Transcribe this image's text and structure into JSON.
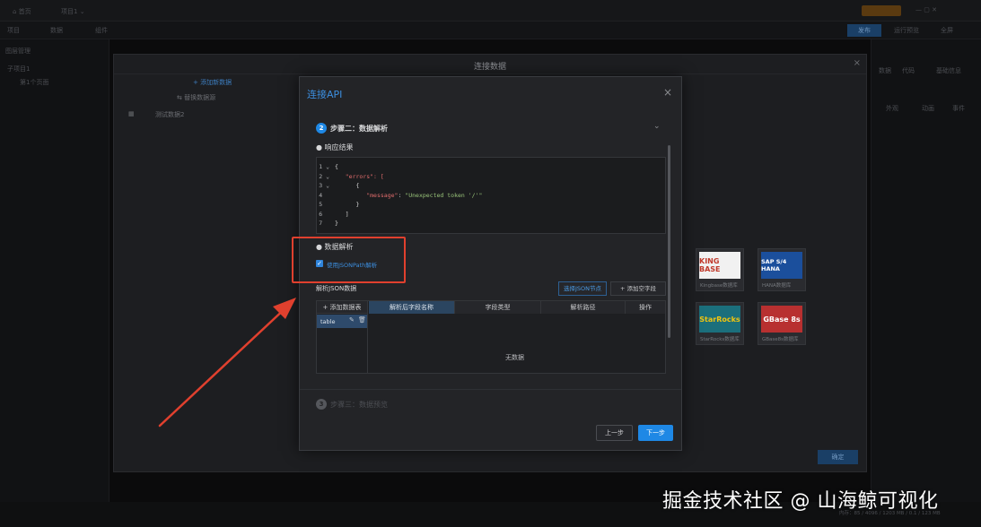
{
  "app": {
    "home_label": "首页",
    "project_label": "项目1",
    "toolbar": [
      "项目",
      "数据",
      "组件"
    ],
    "right_buttons": [
      "发布",
      "运行预览",
      "全屏"
    ],
    "left_panel": {
      "title": "图层管理",
      "group": "子项目1",
      "item": "第1个页面",
      "add_data_label": "+ 添加新数据",
      "replace_source_label": "替换数据源",
      "test_data_label": "测试数据2"
    },
    "right_panel": {
      "tabs": [
        "数据",
        "代码",
        "基础信息"
      ],
      "fields": [
        "外观",
        "动画",
        "事件"
      ]
    },
    "save_label": "确定",
    "bottom_status": "内存：85 / 4096 / 1203 MB / 0.1 / 123 MB"
  },
  "connect_modal": {
    "title": "连接数据",
    "close_icon": "×",
    "cards": [
      {
        "logo": "KING BASE",
        "caption": "Kingbase数据库",
        "logo_color": "#c0392b",
        "logo_bg": "#f1f1f1"
      },
      {
        "logo": "SAP S/4 HANA",
        "caption": "HANA数据库",
        "logo_color": "#ffffff",
        "logo_bg": "#1b4f9c"
      },
      {
        "logo": "StarRocks",
        "caption": "StarRocks数据库",
        "logo_color": "#f1c40f",
        "logo_bg": "#1b6f7c"
      },
      {
        "logo": "GBase 8s",
        "caption": "GBase8s数据库",
        "logo_color": "#ffffff",
        "logo_bg": "#b83030"
      }
    ]
  },
  "dialog": {
    "title": "连接API",
    "close_icon": "×",
    "step2": {
      "num": "2",
      "label": "步骤二：数据解析"
    },
    "step3": {
      "num": "3",
      "label": "步骤三：数据预览"
    },
    "response_label": "● 响应结果",
    "response_lines": [
      {
        "n": "1",
        "text": "{",
        "type": "brace",
        "indent": 0,
        "fold": true
      },
      {
        "n": "2",
        "text": "\"errors\": [",
        "type": "key",
        "indent": 1,
        "fold": true
      },
      {
        "n": "3",
        "text": "{",
        "type": "brace",
        "indent": 2,
        "fold": true
      },
      {
        "n": "4",
        "key": "\"message\"",
        "value": "\"Unexpected token '/'\"",
        "type": "kv",
        "indent": 3,
        "fold": false
      },
      {
        "n": "5",
        "text": "}",
        "type": "brace",
        "indent": 2,
        "fold": false
      },
      {
        "n": "6",
        "text": "]",
        "type": "brace",
        "indent": 1,
        "fold": false
      },
      {
        "n": "7",
        "text": "}",
        "type": "brace",
        "indent": 0,
        "fold": false
      }
    ],
    "parse_section_label": "● 数据解析",
    "checkbox_label": "使用JSONPath解析",
    "checkbox_checked": true,
    "parse_json_label": "解析JSON数据",
    "select_node_button": "选择JSON节点",
    "add_field_button": "+ 添加空字段",
    "add_table_button": "+ 添加数据表",
    "table_item": "table",
    "columns": [
      "解析后字段名称",
      "字段类型",
      "解析路径",
      "操作"
    ],
    "empty_text": "无数据",
    "prev_button": "上一步",
    "next_button": "下一步"
  },
  "watermark": "掘金技术社区 @ 山海鲸可视化",
  "annotation_color": "#e0402e"
}
